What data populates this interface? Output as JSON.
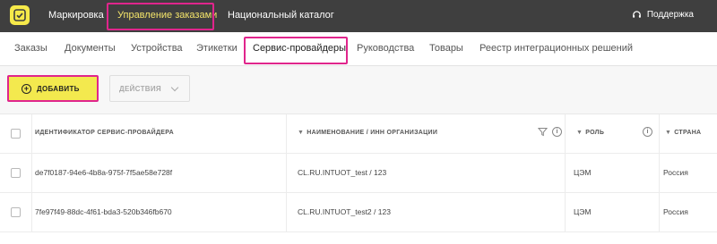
{
  "topbar": {
    "nav": [
      {
        "label": "Маркировка",
        "active": false
      },
      {
        "label": "Управление заказами",
        "active": true
      },
      {
        "label": "Национальный каталог",
        "active": false
      }
    ],
    "support_label": "Поддержка"
  },
  "tabs": [
    {
      "label": "Заказы"
    },
    {
      "label": "Документы"
    },
    {
      "label": "Устройства"
    },
    {
      "label": "Этикетки"
    },
    {
      "label": "Сервис-провайдеры",
      "active": true
    },
    {
      "label": "Руководства"
    },
    {
      "label": "Товары"
    },
    {
      "label": "Реестр интеграционных решений"
    }
  ],
  "toolbar": {
    "add_label": "ДОБАВИТЬ",
    "actions_label": "ДЕЙСТВИЯ"
  },
  "table": {
    "columns": [
      {
        "label": "ИДЕНТИФИКАТОР СЕРВИС-ПРОВАЙДЕРА"
      },
      {
        "label": "НАИМЕНОВАНИЕ / ИНН ОРГАНИЗАЦИИ"
      },
      {
        "label": "РОЛЬ"
      },
      {
        "label": "СТРАНА"
      }
    ],
    "rows": [
      [
        "de7f0187-94e6-4b8a-975f-7f5ae58e728f",
        "CL.RU.INTUOT_test / 123",
        "ЦЭМ",
        "Россия"
      ],
      [
        "7fe97f49-88dc-4f61-bda3-520b346fb670",
        "CL.RU.INTUOT_test2 / 123",
        "ЦЭМ",
        "Россия"
      ]
    ]
  },
  "colors": {
    "topbar": "#3f3f3f",
    "accent_yellow": "#f3e94e",
    "highlight": "#e0258c"
  },
  "icons": [
    "logo-check-icon",
    "headset-icon",
    "plus-circle-icon",
    "chevron-down-icon",
    "filter-icon",
    "info-icon",
    "sort-icon"
  ]
}
